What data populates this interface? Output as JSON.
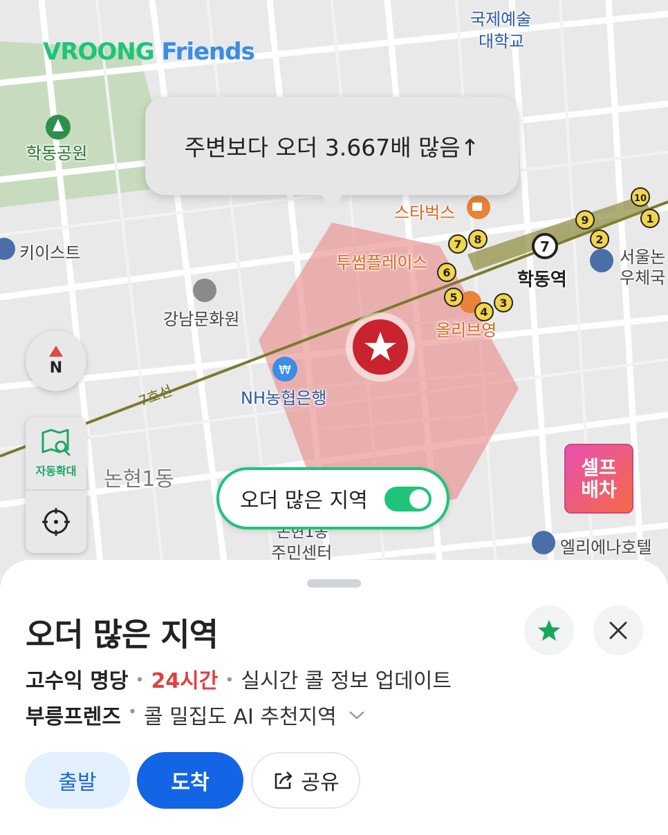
{
  "brand": {
    "logo_main": "VROONG",
    "logo_sub": "Friends"
  },
  "map": {
    "places": {
      "park": "학동공원",
      "univ_line1": "국제예술",
      "univ_line2": "대학교",
      "starbucks": "스타벅스",
      "twosome": "투썸플레이스",
      "station": "학동역",
      "olive": "올리브영",
      "keyist": "키이스트",
      "culture": "강남문화원",
      "bank": "NH농협은행",
      "post_line1": "서울논",
      "post_line2": "우체국",
      "dong": "논현1동",
      "center_line1": "논현1동",
      "center_line2": "주민센터",
      "hotel": "엘리에나호텔",
      "subway_line": "7호선"
    },
    "exits": [
      "1",
      "2",
      "3",
      "4",
      "5",
      "6",
      "7",
      "8",
      "9",
      "10"
    ],
    "station_line_number": "7",
    "zone_color": "#e88a8a"
  },
  "bubble": {
    "text": "주변보다 오더 3.667배 많음↑"
  },
  "compass": {
    "label": "N"
  },
  "controls": {
    "auto_zoom_label": "자동확대"
  },
  "toggle": {
    "label": "오더 많은 지역",
    "on": true
  },
  "self_dispatch": {
    "line1": "셀프",
    "line2": "배차"
  },
  "sheet": {
    "title": "오더 많은 지역",
    "line1": {
      "a": "고수익 명당",
      "b": "24시간",
      "c": "실시간 콜 정보 업데이트"
    },
    "line2": {
      "a": "부릉프렌즈",
      "b": "콜 밀집도 AI 추천지역"
    },
    "buttons": {
      "departure": "출발",
      "arrival": "도착",
      "share": "공유"
    }
  },
  "colors": {
    "brand_green": "#1ec47a",
    "brand_blue": "#1464e6",
    "alert_red": "#e14141"
  }
}
